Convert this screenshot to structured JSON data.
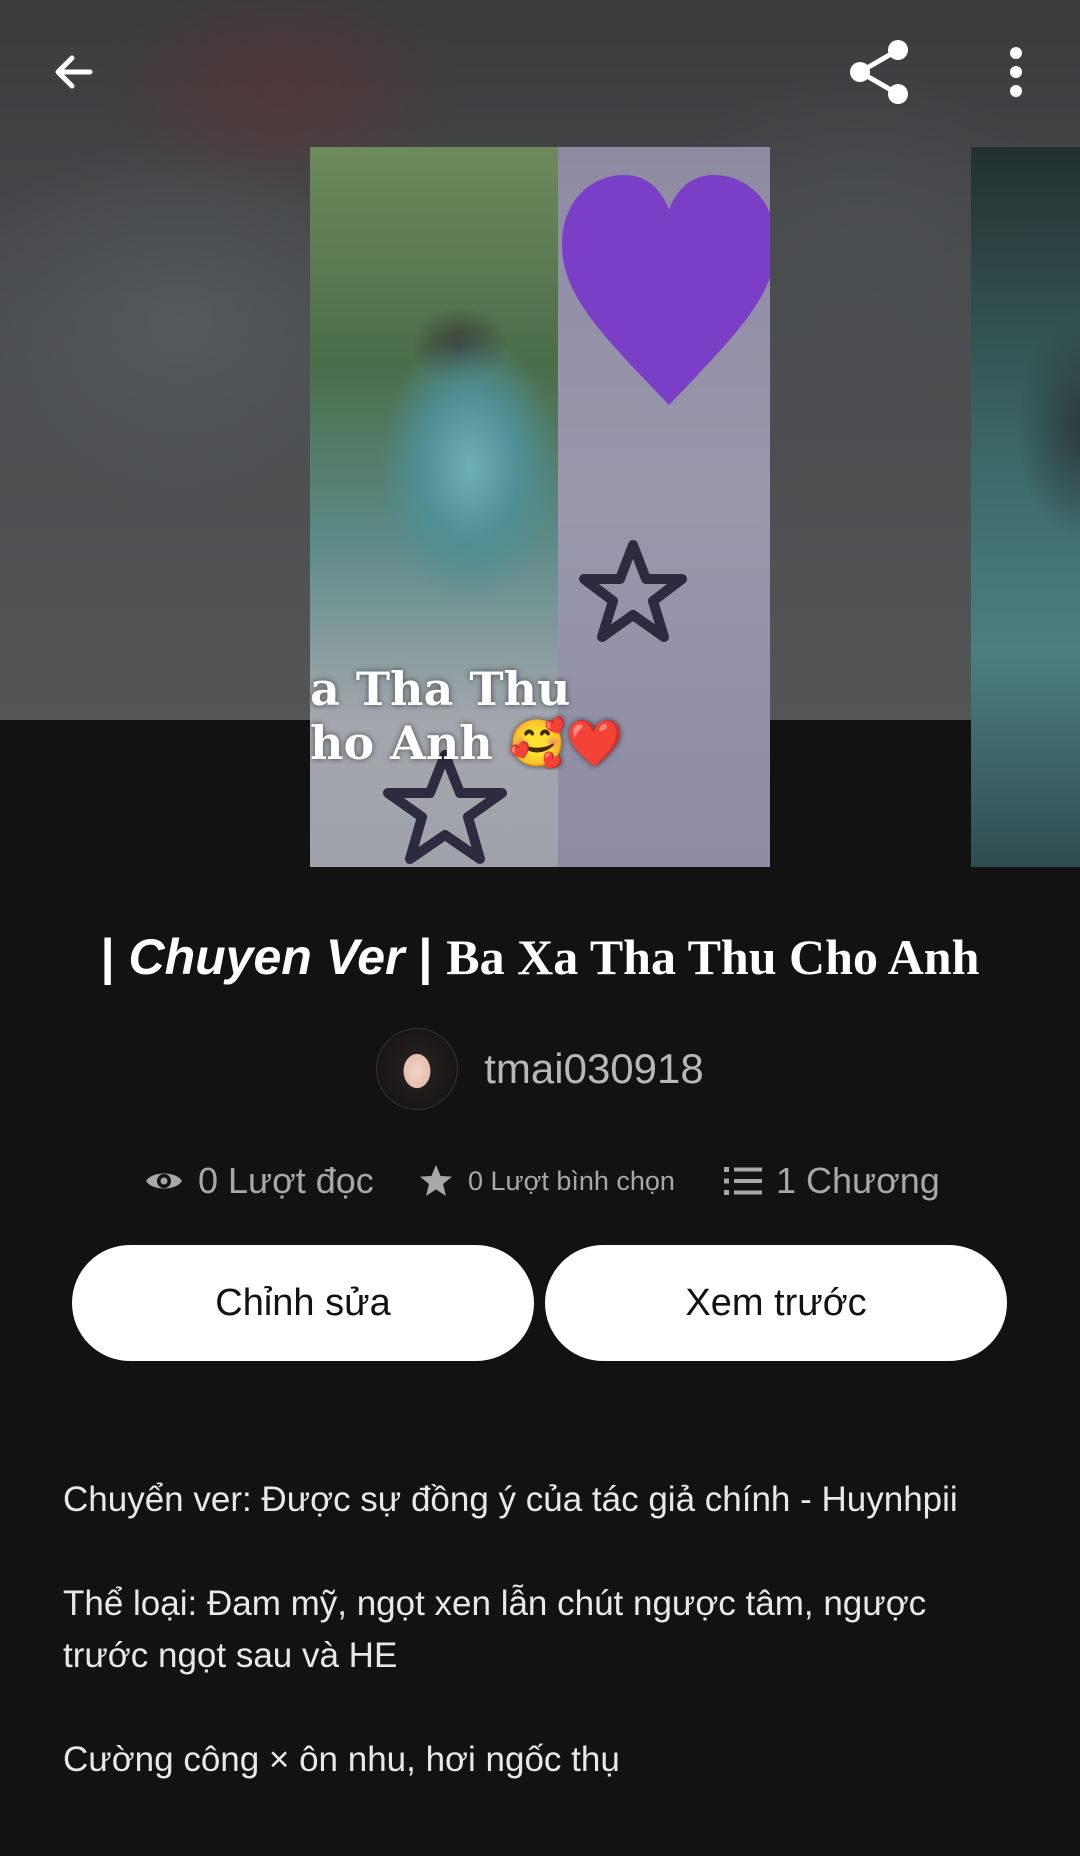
{
  "header": {
    "back_icon": "arrow-left-icon",
    "share_icon": "share-icon",
    "more_icon": "more-vertical-icon"
  },
  "cover": {
    "overlay_line1": "a Tha Thu",
    "overlay_line2": "ho Anh 🥰❤️"
  },
  "story": {
    "title_prefix": "| ",
    "title_italic": "Chuyen Ver",
    "title_sep": " | ",
    "title_main": "Ba Xa Tha Thu Cho Anh",
    "author": "tmai030918"
  },
  "stats": {
    "reads": "0 Lượt đọc",
    "votes": "0 Lượt bình chọn",
    "parts": "1 Chương"
  },
  "actions": {
    "edit_label": "Chỉnh sửa",
    "preview_label": "Xem trước"
  },
  "description": {
    "p1": "Chuyển ver: Được sự đồng ý của tác giả chính - Huynhpii",
    "p2": "Thể loại: Đam mỹ, ngọt xen lẫn chút ngược tâm, ngược trước ngọt sau và HE",
    "p3": "Cường công × ôn nhu, hơi ngốc thụ"
  },
  "colors": {
    "background": "#121212",
    "button_bg": "#ffffff",
    "stat_text": "#a8a8a8"
  }
}
